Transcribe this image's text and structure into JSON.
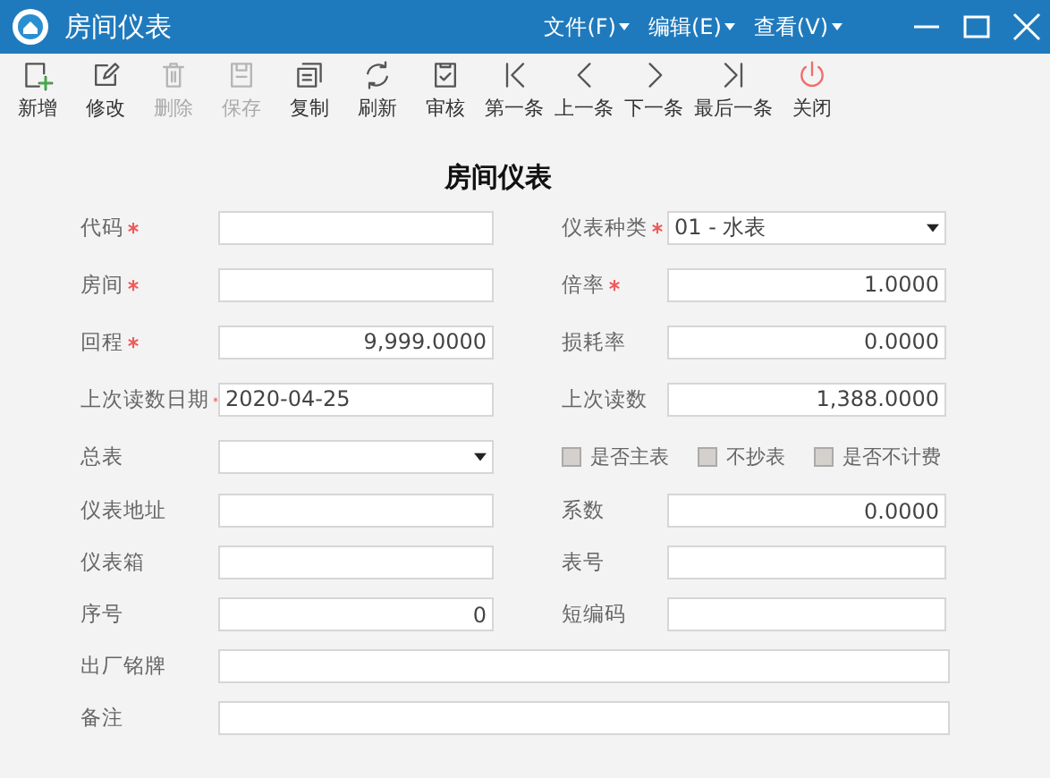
{
  "window": {
    "title": "房间仪表",
    "menus": [
      "文件(F)",
      "编辑(E)",
      "查看(V)"
    ]
  },
  "toolbar": [
    {
      "label": "新增",
      "disabled": false
    },
    {
      "label": "修改",
      "disabled": false
    },
    {
      "label": "删除",
      "disabled": true
    },
    {
      "label": "保存",
      "disabled": true
    },
    {
      "label": "复制",
      "disabled": false
    },
    {
      "label": "刷新",
      "disabled": false
    },
    {
      "label": "审核",
      "disabled": false
    },
    {
      "label": "第一条",
      "disabled": false
    },
    {
      "label": "上一条",
      "disabled": false
    },
    {
      "label": "下一条",
      "disabled": false
    },
    {
      "label": "最后一条",
      "disabled": false
    },
    {
      "label": "关闭",
      "disabled": false
    }
  ],
  "form": {
    "title": "房间仪表",
    "rows": [
      {
        "cells": [
          {
            "label": "代码",
            "required": true,
            "kind": "text"
          },
          {
            "label": "仪表种类",
            "required": true,
            "kind": "select",
            "value": "01 - 水表"
          }
        ]
      },
      {
        "cells": [
          {
            "label": "房间",
            "required": true,
            "kind": "text"
          },
          {
            "label": "倍率",
            "required": true,
            "kind": "number",
            "value": "1.0000"
          }
        ]
      },
      {
        "cells": [
          {
            "label": "回程",
            "required": true,
            "kind": "number",
            "value": "9,999.0000"
          },
          {
            "label": "损耗率",
            "required": false,
            "kind": "number",
            "value": "0.0000"
          }
        ]
      },
      {
        "cells": [
          {
            "label": "上次读数日期",
            "required": true,
            "kind": "text",
            "value": "2020-04-25"
          },
          {
            "label": "上次读数",
            "required": false,
            "kind": "number",
            "value": "1,388.0000"
          }
        ]
      },
      {
        "cells": [
          {
            "label": "总表",
            "required": false,
            "kind": "select"
          }
        ],
        "checkboxes": [
          {
            "label": "是否主表",
            "checked": false
          },
          {
            "label": "不抄表",
            "checked": false
          },
          {
            "label": "是否不计费",
            "checked": false
          }
        ]
      },
      {
        "cells": [
          {
            "label": "仪表地址",
            "required": false,
            "kind": "text"
          },
          {
            "label": "系数",
            "required": false,
            "kind": "number",
            "value": "0.0000"
          }
        ]
      },
      {
        "cells": [
          {
            "label": "仪表箱",
            "required": false,
            "kind": "text"
          },
          {
            "label": "表号",
            "required": false,
            "kind": "text"
          }
        ]
      },
      {
        "cells": [
          {
            "label": "序号",
            "required": false,
            "kind": "number",
            "value": "0"
          },
          {
            "label": "短编码",
            "required": false,
            "kind": "text"
          }
        ]
      },
      {
        "cells": [
          {
            "label": "出厂铭牌",
            "required": false,
            "kind": "text",
            "wide": true
          }
        ]
      },
      {
        "cells": [
          {
            "label": "备注",
            "required": false,
            "kind": "text",
            "wide": true
          }
        ]
      }
    ]
  }
}
